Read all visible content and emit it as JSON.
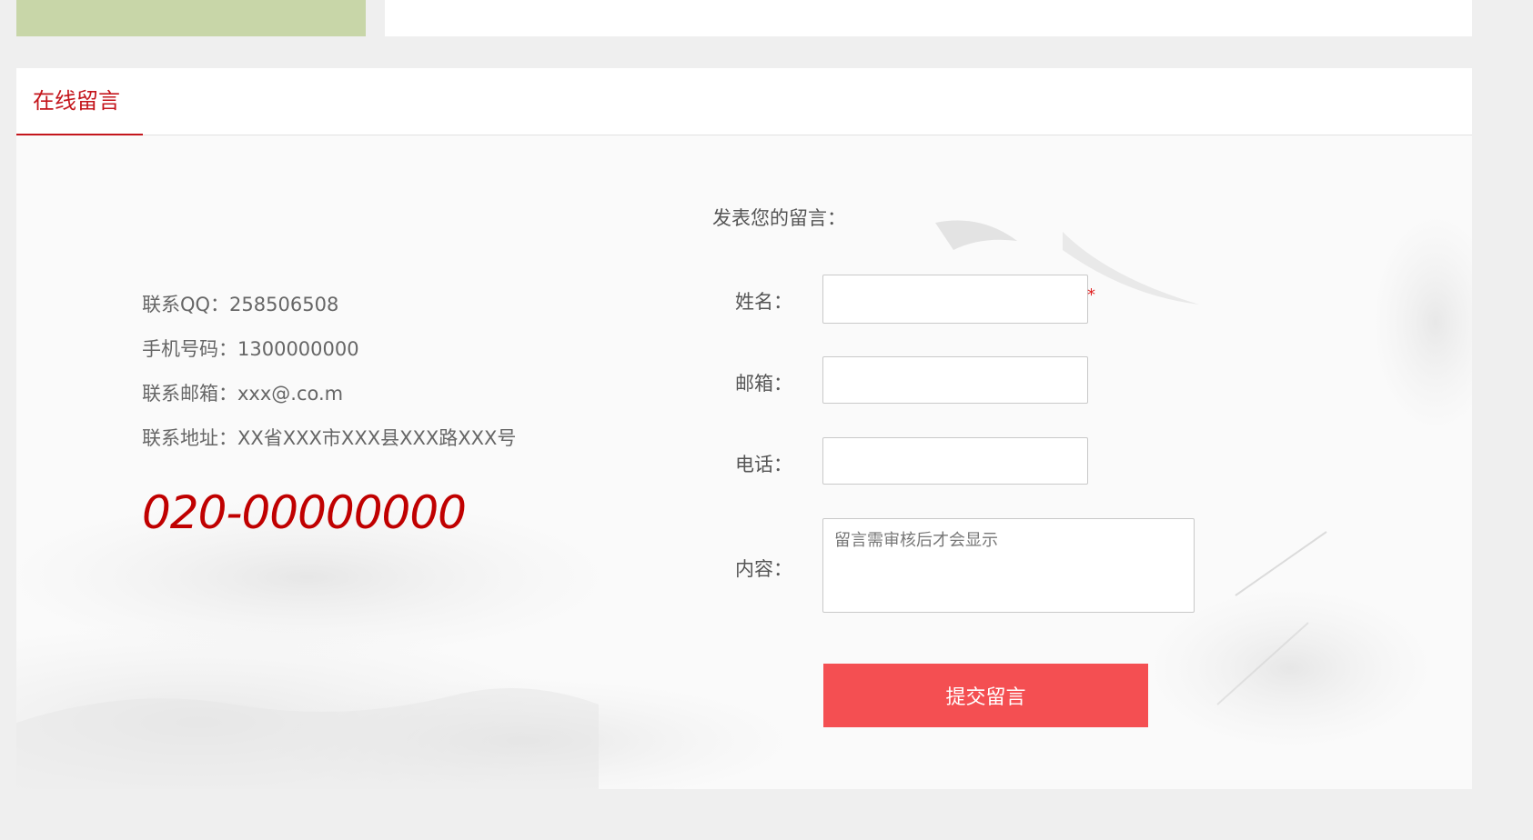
{
  "header": {
    "tab_label": "在线留言"
  },
  "contact": {
    "qq": "联系QQ：258506508",
    "mobile": "手机号码：1300000000",
    "email": "联系邮箱：xxx@.co.m",
    "address": "联系地址：XX省XXX市XXX县XXX路XXX号",
    "hotline": "020-00000000"
  },
  "form": {
    "title": "发表您的留言：",
    "name_label": "姓名：",
    "name_value": "",
    "required_mark": "*",
    "email_label": "邮箱：",
    "email_value": "",
    "phone_label": "电话：",
    "phone_value": "",
    "content_label": "内容：",
    "content_placeholder": "留言需审核后才会显示",
    "submit_label": "提交留言"
  },
  "colors": {
    "accent": "#c4161c",
    "hotline": "#c00000",
    "submit_bg": "#f44f52",
    "top_green": "#c8d6a8"
  }
}
